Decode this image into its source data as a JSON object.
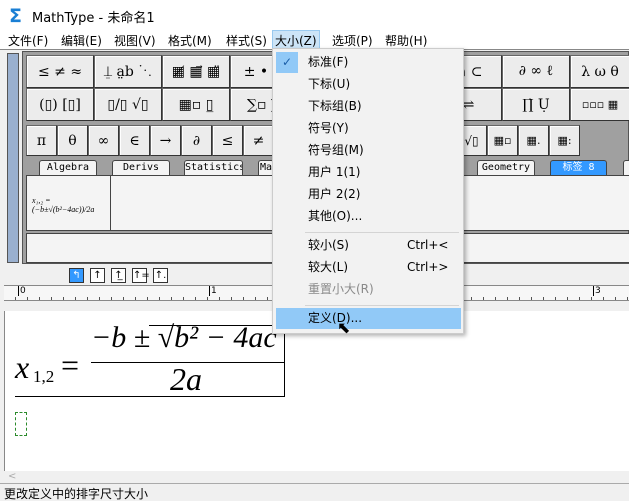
{
  "window": {
    "title": "MathType - 未命名1",
    "logo": "Σ"
  },
  "menubar": [
    "文件(F)",
    "编辑(E)",
    "视图(V)",
    "格式(M)",
    "样式(S)",
    "大小(Z)",
    "选项(P)",
    "帮助(H)"
  ],
  "palette": {
    "row1": [
      "≤ ≠ ≈",
      "⍊ a̤b ⋱",
      "▦̸ ▦⃗ ▦̈",
      "± • ⊗",
      "∩ ⊂",
      "∂ ∞ ℓ",
      "λ ω θ"
    ],
    "row2": [
      "(▯) [▯]",
      "▯/▯ √▯",
      "▦▫ ▯̲",
      "∑▫ ∑̲",
      "⇌",
      "∏̇ Ụ",
      "▫▫▫ ▦"
    ],
    "symbols": [
      "π",
      "θ",
      "∞",
      "∈",
      "→",
      "∂",
      "≤",
      "≠"
    ],
    "symbols_right": [
      "√▯",
      "▦▫",
      "▦.",
      "▦:"
    ],
    "tabs": [
      "Algebra",
      "Derivs",
      "Statistics",
      "Ma",
      "Geometry",
      "标签 8"
    ],
    "template_preview": "x₁,₂ = (−b±√(b²−4ac))/2a"
  },
  "nudge": [
    "↰",
    "↑",
    "↑̲",
    "↑=",
    "↑."
  ],
  "ruler": [
    "0",
    "1",
    "3"
  ],
  "editor": {
    "lhs": "x",
    "sub": "1,2",
    "eq": "=",
    "numerator": "−b ± √b² − 4ac",
    "num_a": "−b ±",
    "num_rad": "b",
    "num_sup": "2",
    "num_rest": " − 4ac",
    "denominator": "2a"
  },
  "dropdown": {
    "items": [
      {
        "label": "标准(F)",
        "checked": true
      },
      {
        "label": "下标(U)"
      },
      {
        "label": "下标组(B)"
      },
      {
        "label": "符号(Y)"
      },
      {
        "label": "符号组(M)"
      },
      {
        "label": "用户 1(1)"
      },
      {
        "label": "用户 2(2)"
      },
      {
        "label": "其他(O)..."
      },
      {
        "label": "较小(S)",
        "shortcut": "Ctrl+<"
      },
      {
        "label": "较大(L)",
        "shortcut": "Ctrl+>"
      },
      {
        "label": "重置小大(R)",
        "disabled": true
      },
      {
        "label": "定义(D)...",
        "highlighted": true
      }
    ],
    "check": "✓"
  },
  "status": "更改定义中的排字尺寸大小",
  "colors": {
    "accent": "#3399ff",
    "menu_highlight": "#91c9f7"
  }
}
